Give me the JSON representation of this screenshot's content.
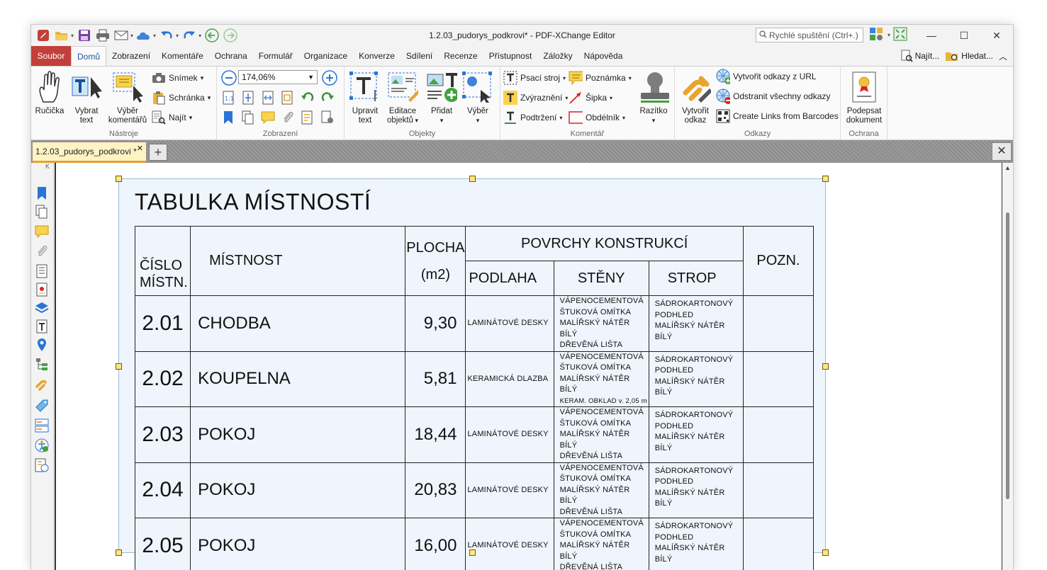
{
  "window": {
    "title": "1.2.03_pudorys_podkrovi* - PDF-XChange Editor",
    "quick_launch_placeholder": "Rychlé spuštění (Ctrl+.)"
  },
  "menu": {
    "tabs": [
      "Soubor",
      "Domů",
      "Zobrazení",
      "Komentáře",
      "Ochrana",
      "Formulář",
      "Organizace",
      "Konverze",
      "Sdílení",
      "Recenze",
      "Přístupnost",
      "Záložky",
      "Nápověda"
    ],
    "find_label": "Najít...",
    "search_label": "Hledat..."
  },
  "ribbon": {
    "tools": {
      "label": "Nástroje",
      "hand": "Ručička",
      "select_text_1": "Vybrat",
      "select_text_2": "text",
      "select_comments_1": "Výběr",
      "select_comments_2": "komentářů",
      "snapshot": "Snímek",
      "clipboard": "Schránka",
      "find": "Najít"
    },
    "view": {
      "label": "Zobrazení",
      "zoom": "174,06%"
    },
    "objects": {
      "label": "Objekty",
      "edit_text_1": "Upravit",
      "edit_text_2": "text",
      "edit_objects_1": "Editace",
      "edit_objects_2": "objektů",
      "add": "Přidat",
      "select": "Výběr"
    },
    "comment": {
      "label": "Komentář",
      "typewriter": "Psací stroj",
      "note": "Poznámka",
      "highlight": "Zvýraznění",
      "arrow": "Šipka",
      "underline": "Podtržení",
      "rectangle": "Obdélník",
      "stamp": "Razítko"
    },
    "links": {
      "label": "Odkazy",
      "create_link_1": "Vytvořit",
      "create_link_2": "odkaz",
      "create_url": "Vytvořit odkazy z URL",
      "remove_all": "Odstranit všechny odkazy",
      "barcodes": "Create Links from Barcodes"
    },
    "protection": {
      "label": "Ochrana",
      "sign_1": "Podepsat",
      "sign_2": "dokument"
    }
  },
  "document_tab": {
    "name": "1.2.03_pudorys_podkrovi *"
  },
  "document": {
    "title": "TABULKA MÍSTNOSTÍ",
    "headers": {
      "number_1": "ČÍSLO",
      "number_2": "MÍSTN.",
      "room": "MÍSTNOST",
      "area_1": "PLOCHA",
      "area_2": "(m2)",
      "surfaces": "POVRCHY KONSTRUKCÍ",
      "floor": "PODLAHA",
      "walls": "STĚNY",
      "ceiling": "STROP",
      "note": "POZN."
    },
    "rows": [
      {
        "number": "2.01",
        "name": "CHODBA",
        "area": "9,30",
        "floor": "LAMINÁTOVÉ DESKY",
        "walls": [
          "VÁPENOCEMENTOVÁ",
          "ŠTUKOVÁ OMÍTKA",
          "MALÍŘSKÝ NÁTĚR BÍLÝ",
          "DŘEVĚNÁ LIŠTA"
        ],
        "ceiling": [
          "SÁDROKARTONOVÝ",
          "PODHLED",
          "MALÍŘSKÝ NÁTĚR BÍLÝ"
        ]
      },
      {
        "number": "2.02",
        "name": "KOUPELNA",
        "area": "5,81",
        "floor": "KERAMICKÁ DLAZBA",
        "walls": [
          "VÁPENOCEMENTOVÁ",
          "ŠTUKOVÁ OMÍTKA",
          "MALÍŘSKÝ NÁTĚR BÍLÝ",
          "KERAM. OBKLAD v. 2,05 m"
        ],
        "ceiling": [
          "SÁDROKARTONOVÝ",
          "PODHLED",
          "MALÍŘSKÝ NÁTĚR BÍLÝ"
        ]
      },
      {
        "number": "2.03",
        "name": "POKOJ",
        "area": "18,44",
        "floor": "LAMINÁTOVÉ DESKY",
        "walls": [
          "VÁPENOCEMENTOVÁ",
          "ŠTUKOVÁ OMÍTKA",
          "MALÍŘSKÝ NÁTĚR BÍLÝ",
          "DŘEVĚNÁ LIŠTA"
        ],
        "ceiling": [
          "SÁDROKARTONOVÝ",
          "PODHLED",
          "MALÍŘSKÝ NÁTĚR BÍLÝ"
        ]
      },
      {
        "number": "2.04",
        "name": "POKOJ",
        "area": "20,83",
        "floor": "LAMINÁTOVÉ DESKY",
        "walls": [
          "VÁPENOCEMENTOVÁ",
          "ŠTUKOVÁ OMÍTKA",
          "MALÍŘSKÝ NÁTĚR BÍLÝ",
          "DŘEVĚNÁ LIŠTA"
        ],
        "ceiling": [
          "SÁDROKARTONOVÝ",
          "PODHLED",
          "MALÍŘSKÝ NÁTĚR BÍLÝ"
        ]
      },
      {
        "number": "2.05",
        "name": "POKOJ",
        "area": "16,00",
        "floor": "LAMINÁTOVÉ DESKY",
        "walls": [
          "VÁPENOCEMENTOVÁ",
          "ŠTUKOVÁ OMÍTKA",
          "MALÍŘSKÝ NÁTĚR BÍLÝ",
          "DŘEVĚNÁ LIŠTA"
        ],
        "ceiling": [
          "SÁDROKARTONOVÝ",
          "PODHLED",
          "MALÍŘSKÝ NÁTĚR BÍLÝ"
        ]
      }
    ]
  },
  "colors": {
    "file_tab": "#c2403a",
    "accent_blue": "#1f57a8",
    "doc_tab_bg": "#fff3c4",
    "selection_bg": "#eef5fc"
  },
  "icons": {
    "sidebar": [
      "bookmarks-icon",
      "pages-icon",
      "comments-icon",
      "attachments-icon",
      "document-icon",
      "certificate-icon",
      "layers-icon",
      "text-icon",
      "destinations-icon",
      "structure-icon",
      "links-icon",
      "tags-icon",
      "fields-icon",
      "accessibility-icon",
      "reading-order-icon"
    ]
  }
}
